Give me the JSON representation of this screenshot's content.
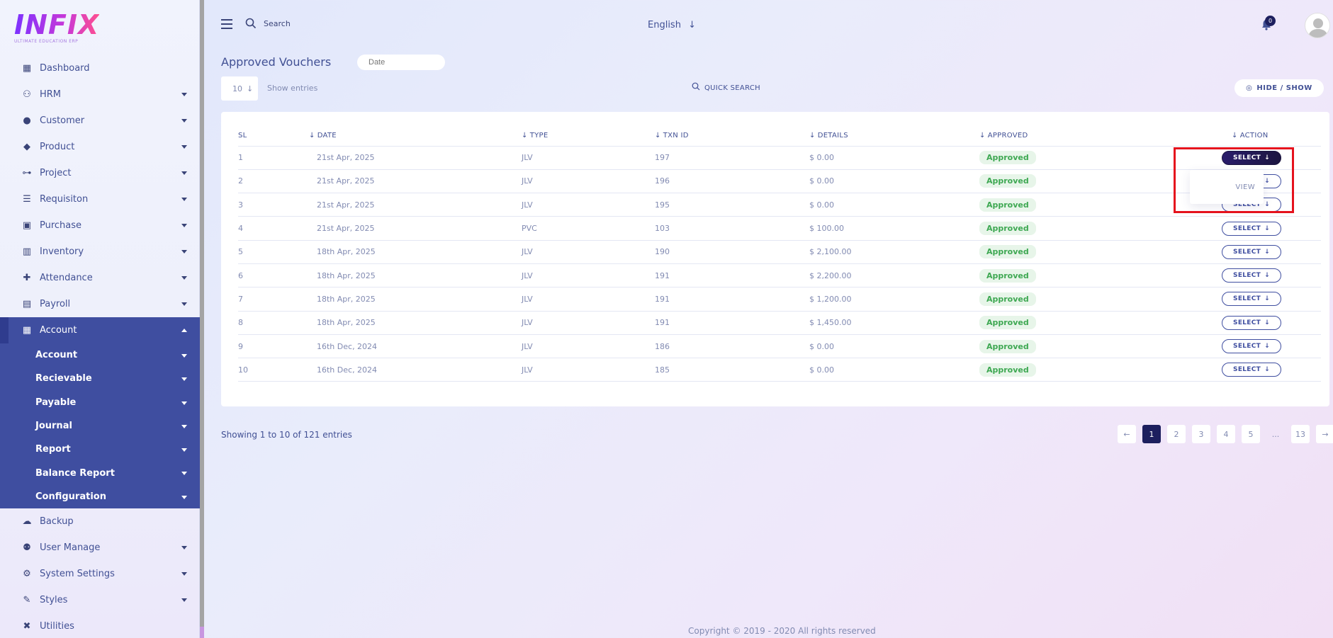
{
  "brand": {
    "name": "INFIX",
    "tagline": "ULTIMATE EDUCATION ERP"
  },
  "sidebar": {
    "items": [
      {
        "label": "Dashboard",
        "icon": "grid-icon"
      },
      {
        "label": "HRM",
        "icon": "users-cog-icon"
      },
      {
        "label": "Customer",
        "icon": "user-icon"
      },
      {
        "label": "Product",
        "icon": "tags-icon"
      },
      {
        "label": "Project",
        "icon": "project-diagram-icon"
      },
      {
        "label": "Requisiton",
        "icon": "list-icon"
      },
      {
        "label": "Purchase",
        "icon": "dolly-icon"
      },
      {
        "label": "Inventory",
        "icon": "barcode-icon"
      },
      {
        "label": "Attendance",
        "icon": "user-plus-icon"
      },
      {
        "label": "Payroll",
        "icon": "money-icon"
      },
      {
        "label": "Account",
        "icon": "calculator-icon"
      }
    ],
    "account_submenu": [
      "Account",
      "Recievable",
      "Payable",
      "Journal",
      "Report",
      "Balance Report",
      "Configuration"
    ],
    "bottom_items": [
      {
        "label": "Backup",
        "icon": "cloud-icon"
      },
      {
        "label": "User Manage",
        "icon": "users-icon"
      },
      {
        "label": "System Settings",
        "icon": "gear-icon"
      },
      {
        "label": "Styles",
        "icon": "brush-icon"
      },
      {
        "label": "Utilities",
        "icon": "tools-icon"
      }
    ]
  },
  "header": {
    "search_label": "Search",
    "language": "English",
    "notification_count": "0"
  },
  "toolbar": {
    "title": "Approved Vouchers",
    "date_placeholder": "Date",
    "entries_value": "10",
    "entries_label": "Show entries",
    "quick_search": "QUICK SEARCH",
    "hide_show": "HIDE / SHOW"
  },
  "table": {
    "headers": [
      "SL",
      "DATE",
      "TYPE",
      "TXN ID",
      "DETAILS",
      "APPROVED",
      "ACTION"
    ],
    "rows": [
      [
        "1",
        "21st Apr, 2025",
        "JLV",
        "197",
        "$ 0.00",
        "Approved",
        "SELECT"
      ],
      [
        "2",
        "21st Apr, 2025",
        "JLV",
        "196",
        "$ 0.00",
        "Approved",
        "SELECT"
      ],
      [
        "3",
        "21st Apr, 2025",
        "JLV",
        "195",
        "$ 0.00",
        "Approved",
        "SELECT"
      ],
      [
        "4",
        "21st Apr, 2025",
        "PVC",
        "103",
        "$ 100.00",
        "Approved",
        "SELECT"
      ],
      [
        "5",
        "18th Apr, 2025",
        "JLV",
        "190",
        "$ 2,100.00",
        "Approved",
        "SELECT"
      ],
      [
        "6",
        "18th Apr, 2025",
        "JLV",
        "191",
        "$ 2,200.00",
        "Approved",
        "SELECT"
      ],
      [
        "7",
        "18th Apr, 2025",
        "JLV",
        "191",
        "$ 1,200.00",
        "Approved",
        "SELECT"
      ],
      [
        "8",
        "18th Apr, 2025",
        "JLV",
        "191",
        "$ 1,450.00",
        "Approved",
        "SELECT"
      ],
      [
        "9",
        "16th Dec, 2024",
        "JLV",
        "186",
        "$ 0.00",
        "Approved",
        "SELECT"
      ],
      [
        "10",
        "16th Dec, 2024",
        "JLV",
        "185",
        "$ 0.00",
        "Approved",
        "SELECT"
      ]
    ],
    "dropdown_item": "VIEW"
  },
  "pagination": {
    "showing": "Showing 1 to 10 of 121 entries",
    "pages": [
      "1",
      "2",
      "3",
      "4",
      "5",
      "...",
      "13"
    ],
    "current": "1"
  },
  "footer": {
    "copyright": "Copyright © 2019 - 2020 All rights reserved"
  },
  "colors": {
    "accent": "#3f4ea0",
    "dark": "#1d1f5e",
    "approved_bg": "#e7f5e9",
    "approved_text": "#3ea852",
    "highlight": "#e5121d"
  }
}
